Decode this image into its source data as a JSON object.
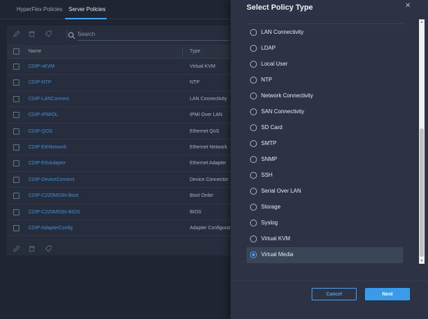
{
  "tabs": [
    {
      "label": "HyperFlex Policies",
      "active": false
    },
    {
      "label": "Server Policies",
      "active": true
    }
  ],
  "toolbar": {
    "search_placeholder": "Search",
    "icons": [
      "edit-icon",
      "delete-icon",
      "tag-icon",
      "search-icon"
    ]
  },
  "table": {
    "columns": [
      "Name",
      "Type"
    ],
    "rows": [
      {
        "name": "CDIP-vKVM",
        "type": "Virtual KVM"
      },
      {
        "name": "CDIP-NTP",
        "type": "NTP"
      },
      {
        "name": "CDIP-LANConnect",
        "type": "LAN Connectivity"
      },
      {
        "name": "CDIP-IPMIOL",
        "type": "IPMI Over LAN"
      },
      {
        "name": "CDIP-QOS",
        "type": "Ethernet QoS"
      },
      {
        "name": "CDIP-EthNetwork",
        "type": "Ethernet Network"
      },
      {
        "name": "CDIP-EthAdapter",
        "type": "Ethernet Adapter"
      },
      {
        "name": "CDIP-DeviceConnect",
        "type": "Device Connector"
      },
      {
        "name": "CDIP-C220M5SN-Boot",
        "type": "Boot Order"
      },
      {
        "name": "CDIP-C220M5SN-BIOS",
        "type": "BIOS"
      },
      {
        "name": "CDIP-AdapterConfig",
        "type": "Adapter Configurat"
      }
    ]
  },
  "modal": {
    "title": "Select Policy Type",
    "close_icon": "close-icon",
    "options": [
      {
        "label": "LAN Connectivity",
        "selected": false
      },
      {
        "label": "LDAP",
        "selected": false
      },
      {
        "label": "Local User",
        "selected": false
      },
      {
        "label": "NTP",
        "selected": false
      },
      {
        "label": "Network Connectivity",
        "selected": false
      },
      {
        "label": "SAN Connectivity",
        "selected": false
      },
      {
        "label": "SD Card",
        "selected": false
      },
      {
        "label": "SMTP",
        "selected": false
      },
      {
        "label": "SNMP",
        "selected": false
      },
      {
        "label": "SSH",
        "selected": false
      },
      {
        "label": "Serial Over LAN",
        "selected": false
      },
      {
        "label": "Storage",
        "selected": false
      },
      {
        "label": "Syslog",
        "selected": false
      },
      {
        "label": "Virtual KVM",
        "selected": false
      },
      {
        "label": "Virtual Media",
        "selected": true
      }
    ],
    "cancel_label": "Cancel",
    "next_label": "Next"
  },
  "colors": {
    "accent": "#4aa3f0",
    "link": "#3f8fd9",
    "modal_bg": "#2b3344",
    "page_bg": "#1e2533"
  }
}
